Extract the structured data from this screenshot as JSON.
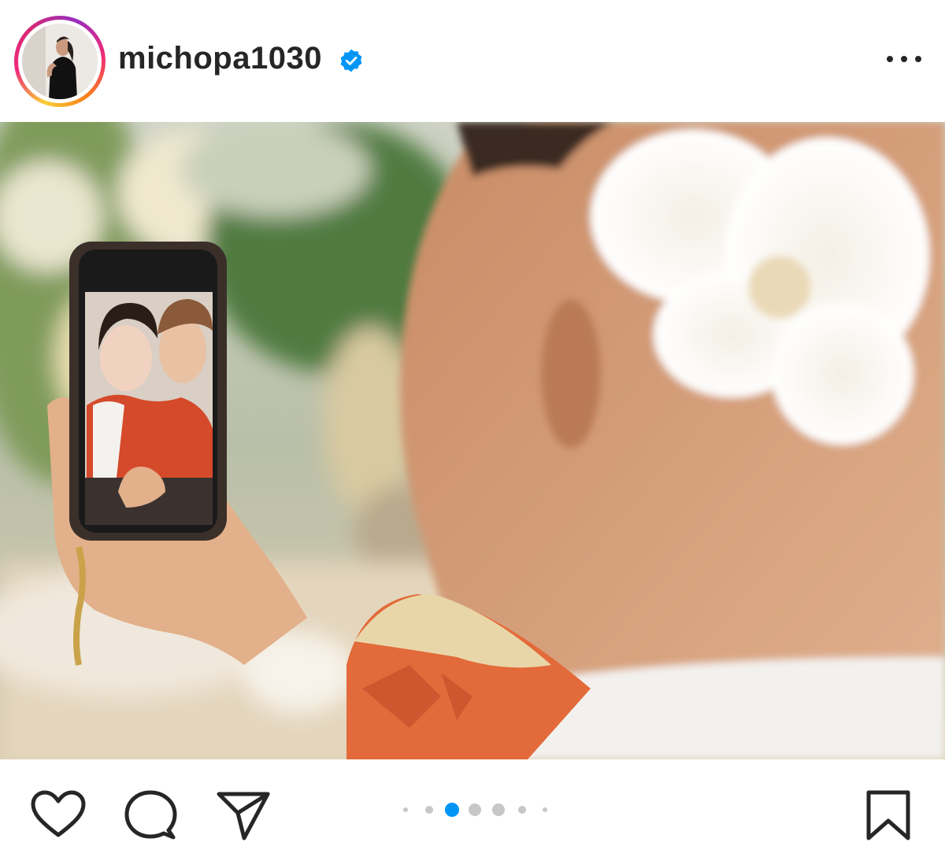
{
  "post": {
    "username": "michopa1030",
    "verified": true,
    "avatar_alt": "profile photo",
    "photo_alt": "photo"
  },
  "icons": {
    "verified": "verified-badge-icon",
    "more": "more-options-icon",
    "like": "heart-icon",
    "comment": "comment-icon",
    "share": "send-icon",
    "save": "bookmark-icon"
  },
  "carousel": {
    "total": 7,
    "active_index": 2
  },
  "colors": {
    "accent": "#0095f6",
    "text": "#262626",
    "dot_inactive": "#c7c7c7"
  }
}
